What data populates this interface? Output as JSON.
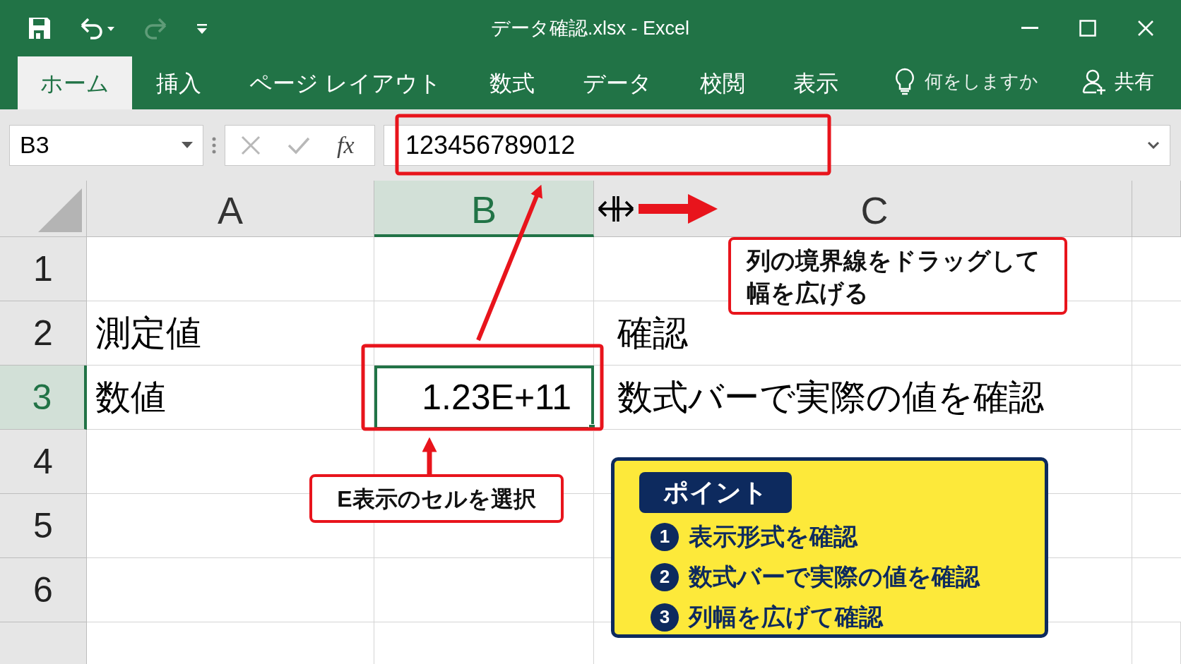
{
  "window": {
    "title": "データ確認.xlsx - Excel"
  },
  "quick_access": [
    {
      "kind": "save",
      "disabled": false
    },
    {
      "kind": "undo",
      "disabled": false
    },
    {
      "kind": "redo",
      "disabled": true
    },
    {
      "kind": "customize",
      "disabled": false
    }
  ],
  "ribbon_tabs": [
    {
      "label": "ホーム",
      "selected": true
    },
    {
      "label": "挿入",
      "selected": false
    },
    {
      "label": "ページ レイアウト",
      "selected": false
    },
    {
      "label": "数式",
      "selected": false
    },
    {
      "label": "データ",
      "selected": false
    },
    {
      "label": "校閲",
      "selected": false
    },
    {
      "label": "表示",
      "selected": false
    }
  ],
  "tell_me": {
    "placeholder": "何をしますか"
  },
  "share": "共有",
  "formula_bar": {
    "name_box": "B3",
    "fx": "fx",
    "value": "123456789012"
  },
  "columns": [
    {
      "label": "A",
      "selected": false
    },
    {
      "label": "B",
      "selected": true
    },
    {
      "label": "C",
      "selected": false
    }
  ],
  "rows": [
    {
      "header": "1",
      "selected": false
    },
    {
      "header": "2",
      "selected": false,
      "a": "測定値",
      "c": "確認"
    },
    {
      "header": "3",
      "selected": true,
      "a": "数値",
      "b": "1.23E+11",
      "c": "数式バーで実際の値を確認"
    },
    {
      "header": "4",
      "selected": false
    },
    {
      "header": "5",
      "selected": false
    },
    {
      "header": "6",
      "selected": false
    }
  ],
  "annotations": {
    "drag_callout": "列の境界線をドラッグして幅を広げる",
    "select_callout": "E表示のセルを選択"
  },
  "point": {
    "title": "ポイント",
    "items": [
      {
        "number": "1",
        "text": "表示形式を確認"
      },
      {
        "number": "2",
        "text": "数式バーで実際の値を確認"
      },
      {
        "number": "3",
        "text": "列幅を広げて確認"
      }
    ]
  }
}
